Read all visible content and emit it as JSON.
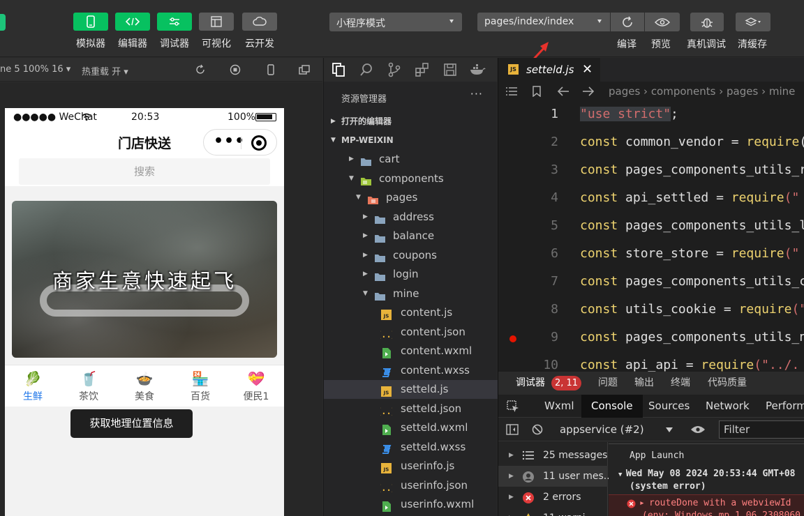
{
  "toolbar": {
    "buttons": [
      {
        "label": "模拟器",
        "icon": "phone-icon"
      },
      {
        "label": "编辑器",
        "icon": "code-icon"
      },
      {
        "label": "调试器",
        "icon": "sliders-icon"
      },
      {
        "label": "可视化",
        "icon": "layout-icon"
      },
      {
        "label": "云开发",
        "icon": "cloud-icon"
      }
    ],
    "mode_select": "小程序模式",
    "page_select": "pages/index/index",
    "right_labels": {
      "compile": "编译",
      "preview": "预览",
      "remote_debug": "真机调试",
      "clear_cache": "清缓存"
    }
  },
  "sim_toolbar": {
    "device": "ne 5 100% 16",
    "hot_reload": "热重载 开"
  },
  "phone": {
    "carrier": "●●●●● WeChat",
    "time": "20:53",
    "battery": "100%",
    "title": "门店快送",
    "capsule_dots": "•••",
    "search_placeholder": "搜索",
    "banner_text": "商家生意快速起飞",
    "tabs": [
      {
        "label": "生鲜",
        "icon": "🥬",
        "active": true
      },
      {
        "label": "茶饮",
        "icon": "🥤",
        "active": false
      },
      {
        "label": "美食",
        "icon": "🍲",
        "active": false
      },
      {
        "label": "百货",
        "icon": "🏪",
        "active": false
      },
      {
        "label": "便民1",
        "icon": "💝",
        "active": false
      }
    ],
    "toast": "获取地理位置信息"
  },
  "explorer": {
    "title": "资源管理器",
    "more": "···",
    "open_editors": "打开的编辑器",
    "project": "MP-WEIXIN",
    "tree": [
      {
        "name": "cart",
        "type": "folder",
        "depth": 1,
        "open": false
      },
      {
        "name": "components",
        "type": "folder-green",
        "depth": 1,
        "open": true
      },
      {
        "name": "pages",
        "type": "folder-red",
        "depth": 2,
        "open": true
      },
      {
        "name": "address",
        "type": "folder",
        "depth": 3,
        "open": false
      },
      {
        "name": "balance",
        "type": "folder",
        "depth": 3,
        "open": false
      },
      {
        "name": "coupons",
        "type": "folder",
        "depth": 3,
        "open": false
      },
      {
        "name": "login",
        "type": "folder",
        "depth": 3,
        "open": false
      },
      {
        "name": "mine",
        "type": "folder",
        "depth": 3,
        "open": true
      },
      {
        "name": "content.js",
        "type": "js",
        "depth": 4
      },
      {
        "name": "content.json",
        "type": "json",
        "depth": 4
      },
      {
        "name": "content.wxml",
        "type": "wxml",
        "depth": 4
      },
      {
        "name": "content.wxss",
        "type": "wxss",
        "depth": 4
      },
      {
        "name": "setteld.js",
        "type": "js",
        "depth": 4,
        "selected": true
      },
      {
        "name": "setteld.json",
        "type": "json",
        "depth": 4
      },
      {
        "name": "setteld.wxml",
        "type": "wxml",
        "depth": 4
      },
      {
        "name": "setteld.wxss",
        "type": "wxss",
        "depth": 4
      },
      {
        "name": "userinfo.js",
        "type": "js",
        "depth": 4
      },
      {
        "name": "userinfo.json",
        "type": "json",
        "depth": 4
      },
      {
        "name": "userinfo.wxml",
        "type": "wxml",
        "depth": 4
      }
    ]
  },
  "editor": {
    "tab_name": "setteld.js",
    "tab_close": "✕",
    "js_badge": "JS",
    "breadcrumb": "pages › components › pages › mine",
    "lines": [
      {
        "n": "1",
        "kw": "",
        "id": "",
        "fn": "",
        "st": "\"use strict\"",
        "rest": ";"
      },
      {
        "n": "2",
        "kw": "const",
        "id": " common_vendor = ",
        "fn": "require",
        "st": "",
        "rest": "("
      },
      {
        "n": "3",
        "kw": "const",
        "id": " pages_components_utils_r",
        "fn": "",
        "st": "",
        "rest": ""
      },
      {
        "n": "4",
        "kw": "const",
        "id": " api_settled = ",
        "fn": "require",
        "st": "(\"",
        "rest": ""
      },
      {
        "n": "5",
        "kw": "const",
        "id": " pages_components_utils_l",
        "fn": "",
        "st": "",
        "rest": ""
      },
      {
        "n": "6",
        "kw": "const",
        "id": " store_store = ",
        "fn": "require",
        "st": "(\"",
        "rest": ""
      },
      {
        "n": "7",
        "kw": "const",
        "id": " pages_components_utils_c",
        "fn": "",
        "st": "",
        "rest": ""
      },
      {
        "n": "8",
        "kw": "const",
        "id": " utils_cookie = ",
        "fn": "require",
        "st": "(\"",
        "rest": ""
      },
      {
        "n": "9",
        "kw": "const",
        "id": " pages_components_utils_n",
        "fn": "",
        "st": "",
        "rest": ""
      },
      {
        "n": "10",
        "kw": "const",
        "id": " api_api = ",
        "fn": "require",
        "st": "(\"../.",
        "rest": ""
      }
    ]
  },
  "devtools": {
    "panel": "调试器",
    "badge": "2, 11",
    "panels": [
      "问题",
      "输出",
      "终端",
      "代码质量"
    ],
    "tabs": [
      "Wxml",
      "Console",
      "Sources",
      "Network",
      "Performa"
    ],
    "active_tab": "Console",
    "context": "appservice (#2)",
    "filter_placeholder": "Filter",
    "messages": [
      {
        "label": "25 messages",
        "icon": "list-icon"
      },
      {
        "label": "11 user mes...",
        "icon": "user-icon",
        "selected": true
      },
      {
        "label": "2 errors",
        "icon": "error-icon"
      },
      {
        "label": "11 warni...",
        "icon": "warning-icon"
      }
    ],
    "log": {
      "app_launch": "App Launch",
      "timestamp": "Wed May 08 2024 20:53:44 GMT+08",
      "system_error": "(system error)",
      "route_error": "routeDone with a webviewId",
      "env_line": "(env: Windows,mp,1.06.2308060"
    }
  }
}
